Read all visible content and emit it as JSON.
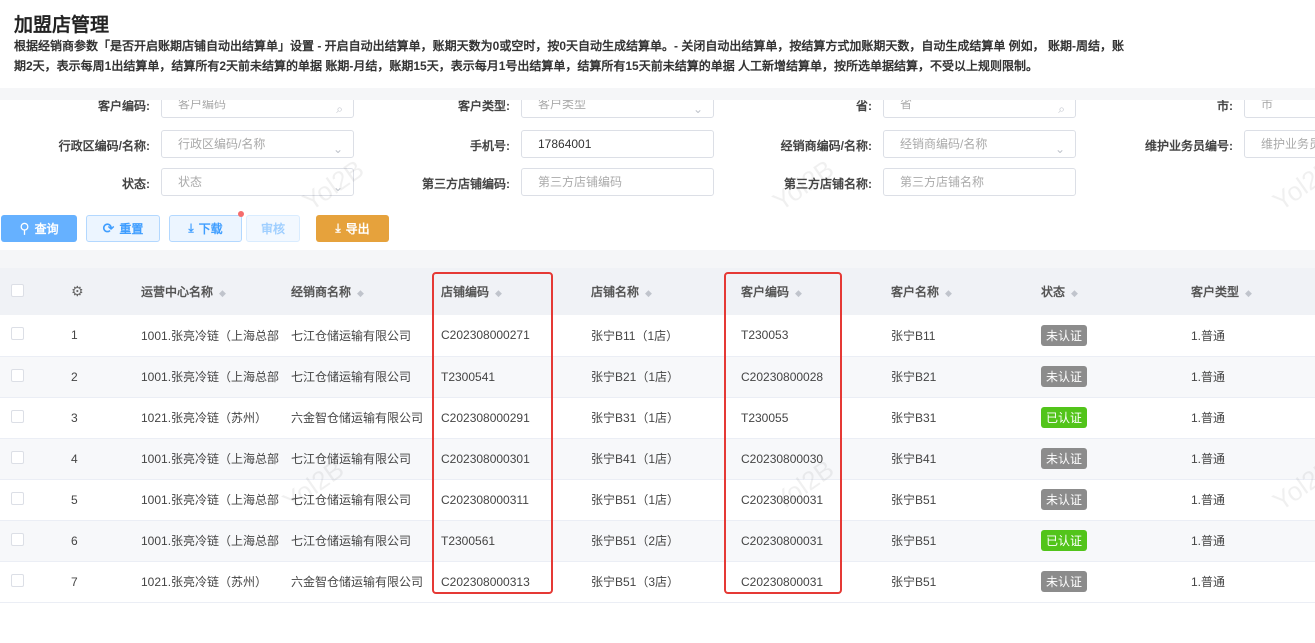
{
  "title": "加盟店管理",
  "description": "根据经销商参数「是否开启账期店铺自动出结算单」设置 - 开启自动出结算单，账期天数为0或空时，按0天自动生成结算单。- 关闭自动出结算单，按结算方式加账期天数，自动生成结算单 例如， 账期-周结，账期2天，表示每周1出结算单，结算所有2天前未结算的单据 账期-月结，账期15天，表示每月1号出结算单，结算所有15天前未结算的单据 人工新增结算单，按所选单据结算，不受以上规则限制。",
  "filters": {
    "customer_code": {
      "label": "客户编码:",
      "placeholder": "客户编码"
    },
    "customer_type": {
      "label": "客户类型:",
      "placeholder": "客户类型"
    },
    "province": {
      "label": "省:",
      "placeholder": "省"
    },
    "city": {
      "label": "市:",
      "placeholder": "市"
    },
    "region": {
      "label": "行政区编码/名称:",
      "placeholder": "行政区编码/名称"
    },
    "phone": {
      "label": "手机号:",
      "value": "17864001"
    },
    "dealer": {
      "label": "经销商编码/名称:",
      "placeholder": "经销商编码/名称"
    },
    "salesman": {
      "label": "维护业务员编号:",
      "placeholder": "维护业务员编号"
    },
    "status": {
      "label": "状态:",
      "placeholder": "状态"
    },
    "third_code": {
      "label": "第三方店铺编码:",
      "placeholder": "第三方店铺编码"
    },
    "third_name": {
      "label": "第三方店铺名称:",
      "placeholder": "第三方店铺名称"
    }
  },
  "buttons": {
    "query": "查询",
    "reset": "重置",
    "download": "下载",
    "audit": "审核",
    "export": "导出"
  },
  "watermark": "Yol2B",
  "columns": [
    "运营中心名称",
    "经销商名称",
    "店铺编码",
    "店铺名称",
    "客户编码",
    "客户名称",
    "状态",
    "客户类型"
  ],
  "status_colors": {
    "未认证": "#8c8c8c",
    "已认证": "#52c41a"
  },
  "rows": [
    [
      "1",
      "1001.张亮冷链（上海总部",
      "七江仓储运输有限公司",
      "C202308000271",
      "张宁B11（1店）",
      "T230053",
      "张宁B11",
      "未认证",
      "1.普通"
    ],
    [
      "2",
      "1001.张亮冷链（上海总部",
      "七江仓储运输有限公司",
      "T2300541",
      "张宁B21（1店）",
      "C20230800028",
      "张宁B21",
      "未认证",
      "1.普通"
    ],
    [
      "3",
      "1021.张亮冷链（苏州）",
      "六金智仓储运输有限公司",
      "C202308000291",
      "张宁B31（1店）",
      "T230055",
      "张宁B31",
      "已认证",
      "1.普通"
    ],
    [
      "4",
      "1001.张亮冷链（上海总部",
      "七江仓储运输有限公司",
      "C202308000301",
      "张宁B41（1店）",
      "C20230800030",
      "张宁B41",
      "未认证",
      "1.普通"
    ],
    [
      "5",
      "1001.张亮冷链（上海总部",
      "七江仓储运输有限公司",
      "C202308000311",
      "张宁B51（1店）",
      "C20230800031",
      "张宁B51",
      "未认证",
      "1.普通"
    ],
    [
      "6",
      "1001.张亮冷链（上海总部",
      "七江仓储运输有限公司",
      "T2300561",
      "张宁B51（2店）",
      "C20230800031",
      "张宁B51",
      "已认证",
      "1.普通"
    ],
    [
      "7",
      "1021.张亮冷链（苏州）",
      "六金智仓储运输有限公司",
      "C202308000313",
      "张宁B51（3店）",
      "C20230800031",
      "张宁B51",
      "未认证",
      "1.普通"
    ]
  ]
}
